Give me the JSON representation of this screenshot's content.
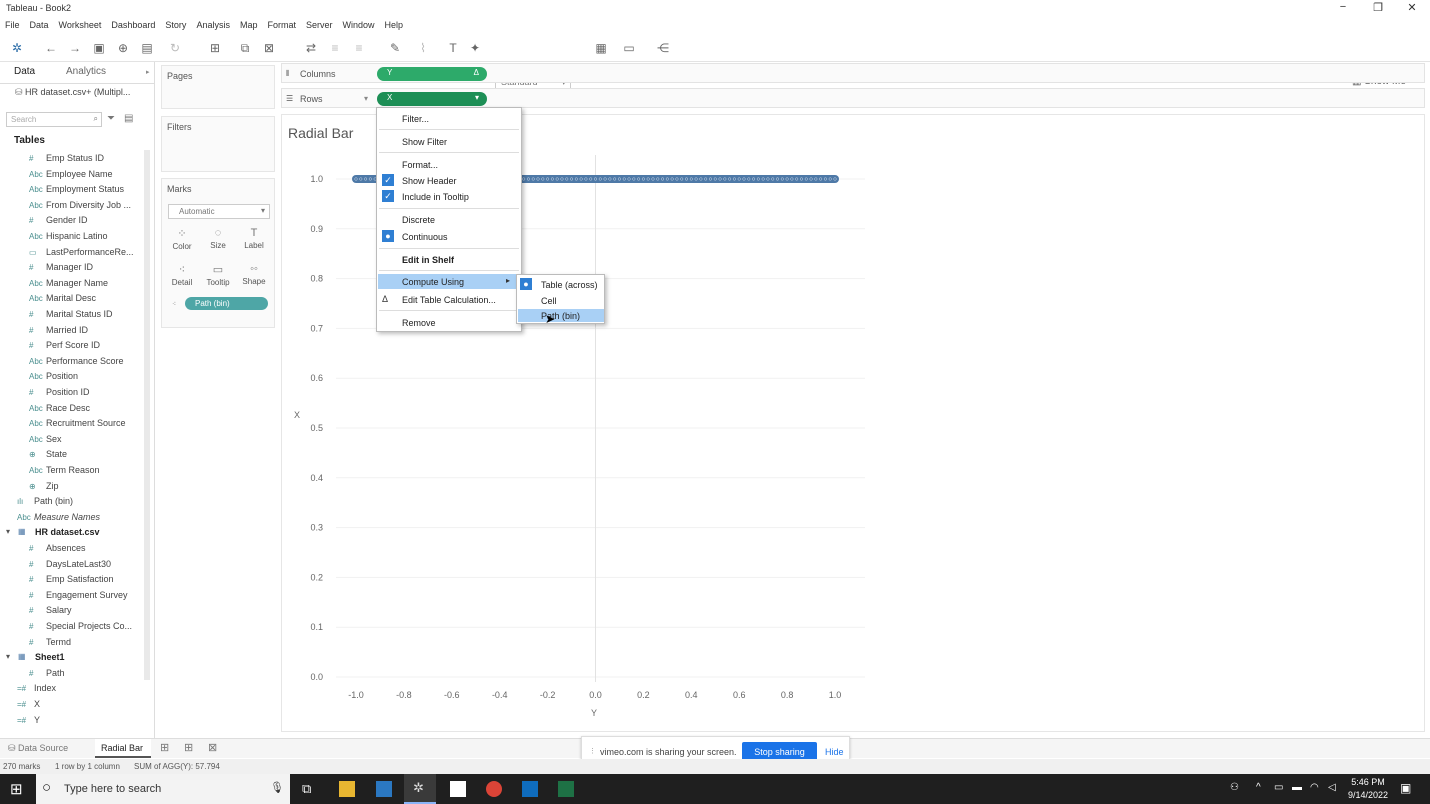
{
  "window": {
    "title": "Tableau - Book2"
  },
  "menu": [
    "File",
    "Data",
    "Worksheet",
    "Dashboard",
    "Story",
    "Analysis",
    "Map",
    "Format",
    "Server",
    "Window",
    "Help"
  ],
  "toolbar": {
    "fit": "Standard",
    "show_me": "Show Me"
  },
  "left_tabs": {
    "data": "Data",
    "analytics": "Analytics"
  },
  "datasource": "HR dataset.csv+ (Multipl...",
  "search_placeholder": "Search",
  "tables_header": "Tables",
  "dim_fields": [
    {
      "icon": "#",
      "name": "Emp Status ID"
    },
    {
      "icon": "Abc",
      "name": "Employee Name"
    },
    {
      "icon": "Abc",
      "name": "Employment Status"
    },
    {
      "icon": "Abc",
      "name": "From Diversity Job ..."
    },
    {
      "icon": "#",
      "name": "Gender ID"
    },
    {
      "icon": "Abc",
      "name": "Hispanic Latino"
    },
    {
      "icon": "▭",
      "name": "LastPerformanceRe..."
    },
    {
      "icon": "#",
      "name": "Manager ID"
    },
    {
      "icon": "Abc",
      "name": "Manager Name"
    },
    {
      "icon": "Abc",
      "name": "Marital Desc"
    },
    {
      "icon": "#",
      "name": "Marital Status ID"
    },
    {
      "icon": "#",
      "name": "Married ID"
    },
    {
      "icon": "#",
      "name": "Perf Score ID"
    },
    {
      "icon": "Abc",
      "name": "Performance Score"
    },
    {
      "icon": "Abc",
      "name": "Position"
    },
    {
      "icon": "#",
      "name": "Position ID"
    },
    {
      "icon": "Abc",
      "name": "Race Desc"
    },
    {
      "icon": "Abc",
      "name": "Recruitment Source"
    },
    {
      "icon": "Abc",
      "name": "Sex"
    },
    {
      "icon": "⊕",
      "name": "State"
    },
    {
      "icon": "Abc",
      "name": "Term Reason"
    },
    {
      "icon": "⊕",
      "name": "Zip"
    }
  ],
  "extra_fields": [
    {
      "icon": "ılı",
      "name": "Path (bin)"
    },
    {
      "icon": "Abc",
      "name": "Measure Names"
    }
  ],
  "hr_table": {
    "name": "HR dataset.csv",
    "fields": [
      "Absences",
      "DaysLateLast30",
      "Emp Satisfaction",
      "Engagement Survey",
      "Salary",
      "Special Projects Co...",
      "Termd"
    ]
  },
  "sheet1_table": {
    "name": "Sheet1",
    "fields": [
      "Path"
    ]
  },
  "calc_fields": [
    "Index",
    "X",
    "Y"
  ],
  "cards": {
    "pages": "Pages",
    "filters": "Filters",
    "marks": "Marks",
    "mark_type": "Automatic",
    "buttons": [
      {
        "label": "Color",
        "icon": "⁘"
      },
      {
        "label": "Size",
        "icon": "◌"
      },
      {
        "label": "Label",
        "icon": "T"
      },
      {
        "label": "Detail",
        "icon": "⁖"
      },
      {
        "label": "Tooltip",
        "icon": "▭"
      },
      {
        "label": "Shape",
        "icon": "◦◦"
      }
    ],
    "detail_pill": "Path (bin)"
  },
  "shelves": {
    "columns_label": "Columns",
    "columns_pill": "Y",
    "rows_label": "Rows",
    "rows_pill": "X",
    "delta": "Δ"
  },
  "sheet_title": "Radial Bar",
  "context_menu": {
    "items": [
      "Filter...",
      "Show Filter",
      "Format...",
      "Show Header",
      "Include in Tooltip",
      "Discrete",
      "Continuous",
      "Edit in Shelf",
      "Compute Using",
      "Edit Table Calculation...",
      "Remove"
    ],
    "submenu": [
      "Table (across)",
      "Cell",
      "Path (bin)"
    ]
  },
  "chart_data": {
    "type": "scatter",
    "title": "Radial Bar",
    "xlabel": "Y",
    "ylabel": "X",
    "x_ticks": [
      "-1.0",
      "-0.8",
      "-0.6",
      "-0.4",
      "-0.2",
      "0.0",
      "0.2",
      "0.4",
      "0.6",
      "0.8",
      "1.0"
    ],
    "y_ticks": [
      "1.0",
      "0.9",
      "0.8",
      "0.7",
      "0.6",
      "0.5",
      "0.4",
      "0.3",
      "0.2",
      "0.1",
      "0.0"
    ],
    "xlim": [
      -1.0,
      1.0
    ],
    "ylim": [
      0.0,
      1.0
    ],
    "series": [
      {
        "y": 1.0,
        "x_from": -1.0,
        "x_to": 1.0
      }
    ],
    "color": "#4e79a7"
  },
  "bottom_tabs": {
    "data_source": "Data Source",
    "sheet": "Radial Bar"
  },
  "sharing": {
    "text": "vimeo.com is sharing your screen.",
    "stop": "Stop sharing",
    "hide": "Hide"
  },
  "status": {
    "marks": "270 marks",
    "rows": "1 row by 1 column",
    "sum": "SUM of AGG(Y): 57.794"
  },
  "taskbar": {
    "search": "Type here to search",
    "time": "5:46 PM",
    "date": "9/14/2022"
  }
}
